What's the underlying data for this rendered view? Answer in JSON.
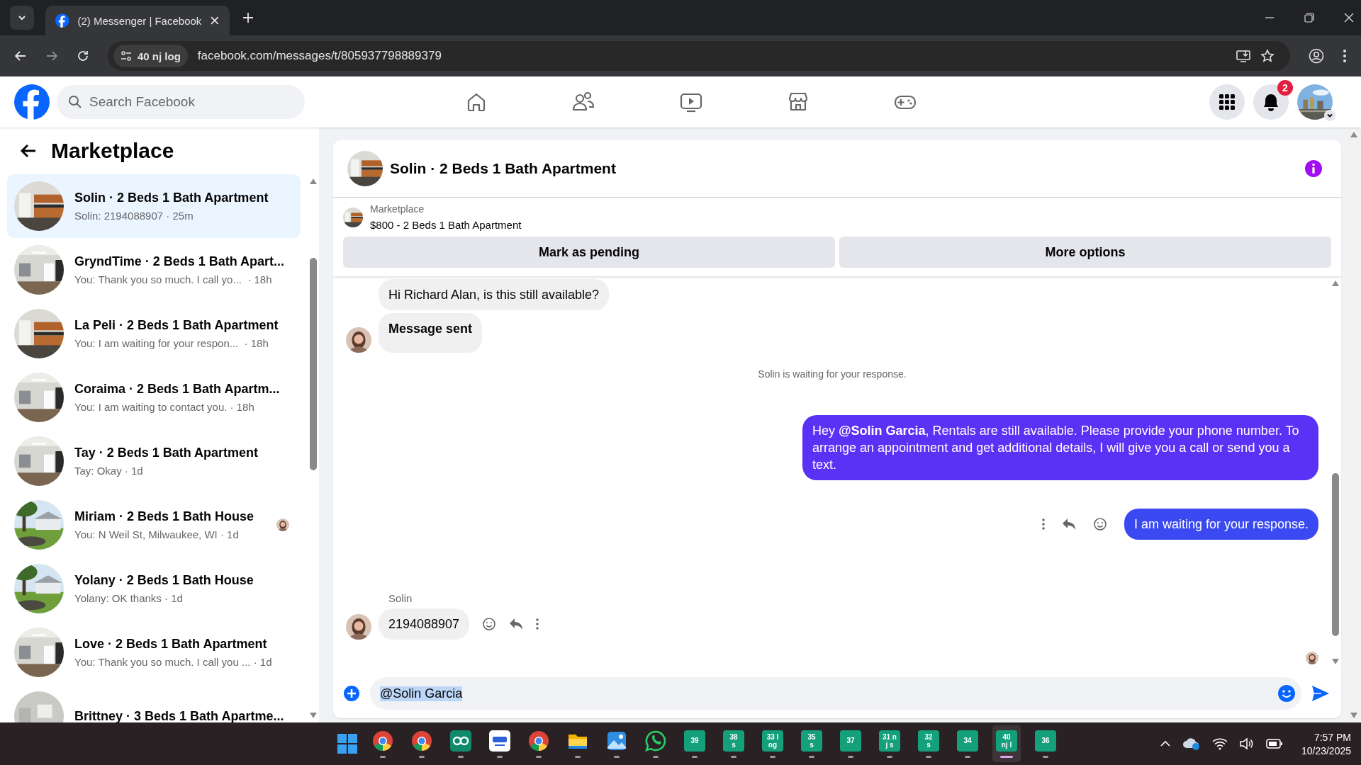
{
  "browser": {
    "tab_title": "(2) Messenger | Facebook",
    "site_chip": "40 nj log",
    "url": "facebook.com/messages/t/805937798889379"
  },
  "header": {
    "search_placeholder": "Search Facebook",
    "notification_count": "2"
  },
  "sidebar": {
    "title": "Marketplace",
    "conversations": [
      {
        "name": "Solin · 2 Beds 1 Bath Apartment",
        "preview": "Solin: 2194088907 · 25m",
        "selected": true,
        "seen": false
      },
      {
        "name": "GryndTime · 2 Beds 1 Bath Apart...",
        "preview": "You: Thank you so much. I call yo...  · 18h",
        "selected": false,
        "seen": false
      },
      {
        "name": "La Peli · 2 Beds 1 Bath Apartment",
        "preview": "You: I am waiting for your respon...  · 18h",
        "selected": false,
        "seen": false
      },
      {
        "name": "Coraima · 2 Beds 1 Bath Apartm...",
        "preview": "You: I am waiting to contact you. · 18h",
        "selected": false,
        "seen": false
      },
      {
        "name": "Tay · 2 Beds 1 Bath Apartment",
        "preview": "Tay: Okay · 1d",
        "selected": false,
        "seen": false
      },
      {
        "name": "Miriam · 2 Beds 1 Bath House",
        "preview": "You: N Weil St, Milwaukee, WI · 1d",
        "selected": false,
        "seen": true
      },
      {
        "name": "Yolany · 2 Beds 1 Bath House",
        "preview": "Yolany: OK thanks · 1d",
        "selected": false,
        "seen": false
      },
      {
        "name": "Love · 2 Beds 1 Bath Apartment",
        "preview": "You: Thank you so much. I call you ... · 1d",
        "selected": false,
        "seen": false
      },
      {
        "name": "Brittney · 3 Beds 1 Bath Apartme...",
        "selected": false,
        "seen": false
      }
    ]
  },
  "chat": {
    "title": "Solin · 2 Beds 1 Bath Apartment",
    "listing_source": "Marketplace",
    "listing": "$800 - 2 Beds 1 Bath Apartment",
    "buttons": [
      "Mark as pending",
      "More options"
    ],
    "messages": [
      {
        "kind": "incoming",
        "text": "Hi Richard Alan, is this still available?",
        "avatar": false,
        "emphasis": false,
        "actions": false
      },
      {
        "kind": "incoming",
        "text": "Message sent",
        "avatar": true,
        "emphasis": true,
        "actions": false
      },
      {
        "kind": "notice",
        "text": "Solin is waiting for your response."
      },
      {
        "kind": "outgoing",
        "text": "Hey **@Solin Garcia**, Rentals are still available. Please provide your phone number. To arrange an appointment and get additional details, I will give you a call or send you a text.",
        "actions": false
      },
      {
        "kind": "outgoing",
        "text": "I am waiting for your response.",
        "actions": true
      },
      {
        "kind": "incoming",
        "sender": "Solin",
        "text": "2194088907",
        "avatar": true,
        "emphasis": false,
        "actions": true
      }
    ],
    "composer_value": "@Solin Garcia"
  },
  "taskbar": {
    "apps": [
      {
        "kind": "browser",
        "active": false
      },
      {
        "kind": "browser",
        "active": false
      },
      {
        "kind": "loop",
        "active": false
      },
      {
        "kind": "reader",
        "active": false
      },
      {
        "kind": "browser",
        "active": false
      },
      {
        "kind": "files",
        "active": false
      },
      {
        "kind": "photos",
        "active": false
      },
      {
        "kind": "chat",
        "active": false
      },
      {
        "kind": "tile",
        "lines": [
          "39"
        ],
        "active": false
      },
      {
        "kind": "tile",
        "lines": [
          "38",
          "s"
        ],
        "active": false
      },
      {
        "kind": "tile",
        "lines": [
          "33 l",
          "og"
        ],
        "active": false
      },
      {
        "kind": "tile",
        "lines": [
          "35",
          "s"
        ],
        "active": false
      },
      {
        "kind": "tile",
        "lines": [
          "37"
        ],
        "active": false
      },
      {
        "kind": "tile",
        "lines": [
          "31 n",
          "j s"
        ],
        "active": false
      },
      {
        "kind": "tile",
        "lines": [
          "32",
          "s"
        ],
        "active": false
      },
      {
        "kind": "tile",
        "lines": [
          "34"
        ],
        "active": false
      },
      {
        "kind": "tile",
        "lines": [
          "40",
          "nj l"
        ],
        "active": true
      },
      {
        "kind": "tile",
        "lines": [
          "36"
        ],
        "active": false
      }
    ],
    "time": "7:57 PM",
    "date": "10/23/2025"
  }
}
